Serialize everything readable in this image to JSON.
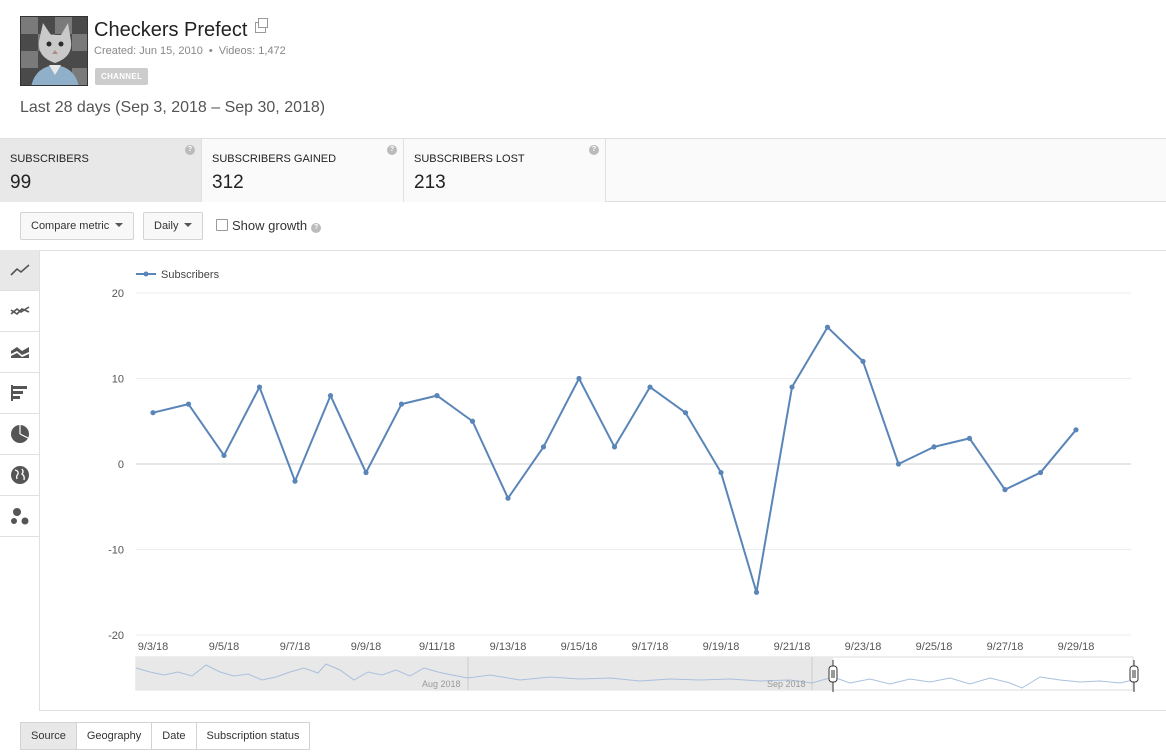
{
  "channel": {
    "name": "Checkers Prefect",
    "created": "Created: Jun 15, 2010",
    "separator": "•",
    "videos": "Videos: 1,472",
    "badge": "CHANNEL"
  },
  "date_range": "Last 28 days (Sep 3, 2018 – Sep 30, 2018)",
  "metrics": [
    {
      "label": "SUBSCRIBERS",
      "value": "99",
      "active": true
    },
    {
      "label": "SUBSCRIBERS GAINED",
      "value": "312",
      "active": false
    },
    {
      "label": "SUBSCRIBERS LOST",
      "value": "213",
      "active": false
    }
  ],
  "controls": {
    "compare_metric": "Compare metric",
    "interval": "Daily",
    "show_growth": "Show growth",
    "show_growth_checked": false
  },
  "sidebar_icons": [
    "line-chart-icon",
    "multi-line-chart-icon",
    "stacked-area-icon",
    "bar-chart-icon",
    "pie-chart-icon",
    "globe-map-icon",
    "bubble-chart-icon"
  ],
  "chart_data": {
    "type": "line",
    "series": [
      {
        "name": "Subscribers",
        "color": "#5a85b8",
        "values": [
          6,
          7,
          1,
          9,
          -2,
          8,
          -1,
          7,
          8,
          5,
          -4,
          2,
          10,
          2,
          9,
          6,
          -1,
          -15,
          9,
          16,
          12,
          0,
          2,
          3,
          -3,
          -1,
          4
        ]
      }
    ],
    "x_tick_labels": [
      "9/3/18",
      "9/5/18",
      "9/7/18",
      "9/9/18",
      "9/11/18",
      "9/13/18",
      "9/15/18",
      "9/17/18",
      "9/19/18",
      "9/21/18",
      "9/23/18",
      "9/25/18",
      "9/27/18",
      "9/29/18"
    ],
    "y_ticks": [
      20,
      10,
      0,
      -10,
      -20
    ],
    "ylim": [
      -20,
      20
    ],
    "grid": true,
    "legend": "top-left",
    "navigator_labels": [
      "Aug 2018",
      "Sep 2018"
    ]
  },
  "bottom_tabs": [
    {
      "label": "Source",
      "active": true
    },
    {
      "label": "Geography",
      "active": false
    },
    {
      "label": "Date",
      "active": false
    },
    {
      "label": "Subscription status",
      "active": false
    }
  ]
}
